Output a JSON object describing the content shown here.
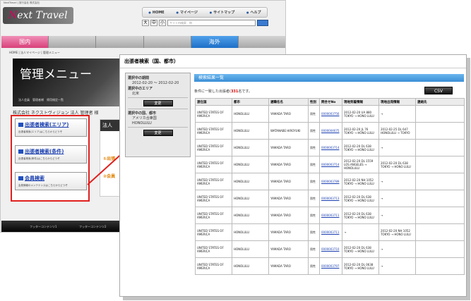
{
  "background_page": {
    "page_title_text": "NextTravel | 旅行会社 株式会社",
    "logo": {
      "prefix": "N",
      "text": "ext Travel"
    },
    "top_links": [
      "HOME",
      "マイページ",
      "サイトマップ",
      "ヘルプ"
    ],
    "font_size_buttons": [
      "大",
      "中",
      "小"
    ],
    "search_placeholder": "サイト内検索　例",
    "global_nav": {
      "domestic": "国内",
      "international": "海外"
    },
    "breadcrumb": "HOME | 法人マイページ | 管理メニュー",
    "menu_title": "管理メニュー",
    "menu_tabs": "法人会員　管理者様　帰用検定一覧",
    "company_line": "株式会社 ネクストヴィジョン 法人 管理者 様",
    "side_buttons": [
      {
        "title": "出張者検索(エリア)",
        "desc": "出張者検索(エリア)はこちらからどうぞ"
      },
      {
        "title": "出張者検索(条件)",
        "desc": "出張者検索(条件)はこちらからどうぞ"
      },
      {
        "title": "会員検索",
        "desc": "会員情報のメンテナンスはこちらからどうぞ"
      }
    ],
    "right_panel": {
      "header": "法人",
      "item1": "①出張",
      "item2": "②会員"
    },
    "footer_links": [
      "フッターコンテンツ1",
      "フッターコンテンツ2"
    ]
  },
  "window": {
    "title": "出張者検索（国、都市）",
    "selection": {
      "period_label": "選択中の期間",
      "period_value": "2012-02-20 〜 2012-02-20",
      "area_label": "選択中のエリア",
      "area_value": "北米",
      "change_button": "変更",
      "country_city_label": "選択中の国、都市",
      "country_value": "アメリカ合衆国",
      "city_value": "HONOLULU",
      "change_button2": "変更"
    },
    "results_header": "検索結果一覧",
    "results_note": {
      "prefix": "条件に一致した出張者(",
      "count": "331",
      "suffix": "名です。"
    },
    "csv_button": "CSV",
    "table": {
      "columns": [
        "渡在国",
        "都市",
        "遅職名名",
        "性別",
        "問合せNo",
        "現地到着情報",
        "現地出発情報",
        "連絡先"
      ],
      "rows": [
        [
          "UNITED STATES OF AMERICA",
          "HONOLULU",
          "YAMADA TARO",
          "男性",
          "0000003756",
          "2012-02-20 UA 880 TOKYO → HONO LULU",
          "→",
          ""
        ],
        [
          "UNITED STATES OF AMERICA",
          "HONOLULU",
          "WATANABE HIROYUKI",
          "男性",
          "0000004675",
          "2012-02-20 JL 76 TOKYO → HONO LULU",
          "2012-02-25 DL 647 HONOLULU → TOKYO",
          ""
        ],
        [
          "UNITED STATES OF AMERICA",
          "HONOLULU",
          "YAMADA TARO",
          "男性",
          "0000003714",
          "2012-02-20 DL 638 TOKYO → HONO LULU",
          "→",
          ""
        ],
        [
          "UNITED STATES OF AMERICA",
          "HONOLULU",
          "YAMADA TARO",
          "男性",
          "0000003714",
          "2012-02-20 DL 1559 LOS ANGELES → HONOLULU",
          "2012-02-20 DL 638 TOKYO → HONO LULU",
          ""
        ],
        [
          "UNITED STATES OF AMERICA",
          "HONOLULU",
          "YAMADA TARO",
          "男性",
          "0000003789",
          "2012-02-20 NH 1052 TOKYO → HONO LULU",
          "→",
          ""
        ],
        [
          "UNITED STATES OF AMERICA",
          "HONOLULU",
          "YAMADA TARO",
          "男性",
          "0000003713",
          "2012-02-20 DL 638 TOKYO → HONO LULU",
          "→",
          ""
        ],
        [
          "UNITED STATES OF AMERICA",
          "HONOLULU",
          "YAMADA TARO",
          "男性",
          "0000003711",
          "2012-02-20 DL 638 TOKYO → HONO LULU",
          "→",
          ""
        ],
        [
          "UNITED STATES OF AMERICA",
          "HONOLULU",
          "YAMADA TARO",
          "男性",
          "0000003711",
          "→",
          "2012-02-20 NH 1052 TOKYO → HONO LULU",
          ""
        ],
        [
          "UNITED STATES OF AMERICA",
          "HONOLULU",
          "YAMADA TARO",
          "男性",
          "0000003710",
          "2012-02-20 DL 638 TOKYO → HONO LULU",
          "→",
          ""
        ],
        [
          "UNITED STATES OF AMERICA",
          "HONOLULU",
          "YAMADA TARO",
          "男性",
          "0000003797",
          "2012-02-20 DL 0638 TOKYO → HONO LULU",
          "→",
          ""
        ]
      ]
    }
  },
  "colors": {
    "accent_pink": "#d8407a",
    "accent_blue": "#1e6fc7",
    "highlight_red": "#e0201f"
  }
}
